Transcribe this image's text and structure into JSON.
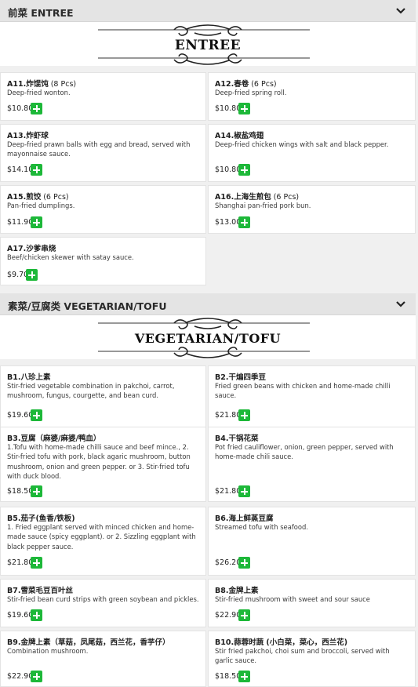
{
  "sections": [
    {
      "title": "前菜 ENTREE",
      "banner": "ENTREE",
      "items": [
        {
          "code": "A11.",
          "name": "炸馄饨",
          "suffix": " (8 Pcs)",
          "desc": "Deep-fried wonton.",
          "price": "$10.80"
        },
        {
          "code": "A12.",
          "name": "春卷",
          "suffix": " (6 Pcs)",
          "desc": "Deep-fried spring roll.",
          "price": "$10.80"
        },
        {
          "code": "A13.",
          "name": "炸虾球",
          "suffix": "",
          "desc": "Deep-fried prawn balls with egg and bread, served with mayonnaise sauce.",
          "price": "$14.10"
        },
        {
          "code": "A14.",
          "name": "椒盐鸡翅",
          "suffix": "",
          "desc": "Deep-fried chicken wings with salt and black pepper.",
          "price": "$10.80"
        },
        {
          "code": "A15.",
          "name": "煎饺",
          "suffix": " (6 Pcs)",
          "desc": "Pan-fried dumplings.",
          "price": "$11.90"
        },
        {
          "code": "A16.",
          "name": "上海生煎包",
          "suffix": " (6 Pcs)",
          "desc": "Shanghai pan-fried pork bun.",
          "price": "$13.00"
        },
        {
          "code": "A17.",
          "name": "沙爹串烧",
          "suffix": "",
          "desc": "Beef/chicken skewer with satay sauce.",
          "price": "$9.70"
        }
      ]
    },
    {
      "title": "素菜/豆腐类 VEGETARIAN/TOFU",
      "banner": "VEGETARIAN/TOFU",
      "items": [
        {
          "code": "B1.",
          "name": "八珍上素",
          "suffix": "",
          "desc": "Stir-fried vegetable combination in pakchoi, carrot, mushroom, fungus, courgette, and bean curd.",
          "price": "$19.60"
        },
        {
          "code": "B2.",
          "name": "干煸四季豆",
          "suffix": "",
          "desc": "Fried green beans with chicken and home-made chilli sauce.",
          "price": "$21.80"
        },
        {
          "code": "B3.",
          "name": "豆腐（麻婆/麻婆/鸭血）",
          "suffix": "",
          "desc": "1.Tofu with home-made chilli sauce and beef mince., 2. Stir-fried tofu with pork, black agaric mushroom, button mushroom, onion and green pepper. or 3. Stir-fried tofu with duck blood.",
          "price": "$18.50"
        },
        {
          "code": "B4.",
          "name": "干锅花菜",
          "suffix": "",
          "desc": "Pot fried cauliflower, onion, green pepper, served with home-made chili sauce.",
          "price": "$21.80"
        },
        {
          "code": "B5.",
          "name": "茄子(鱼香/铁板)",
          "suffix": "",
          "desc": "1. Fried eggplant served with minced chicken and home-made sauce (spicy eggplant). or 2. Sizzling eggplant with black pepper sauce.",
          "price": "$21.80"
        },
        {
          "code": "B6.",
          "name": "海上鲜蒸豆腐",
          "suffix": "",
          "desc": "Streamed tofu with seafood.",
          "price": "$26.20"
        },
        {
          "code": "B7.",
          "name": "雪菜毛豆百叶丝",
          "suffix": "",
          "desc": "Stir-fried bean curd strips with green soybean and pickles.",
          "price": "$19.60"
        },
        {
          "code": "B8.",
          "name": "金牌上素",
          "suffix": "",
          "desc": "Stir-fried mushroom with sweet and sour sauce",
          "price": "$22.90"
        },
        {
          "code": "B9.",
          "name": "金牌上素（草菇，凤尾菇，西兰花，香芋仔）",
          "suffix": "",
          "desc": "Combination mushroom.",
          "price": "$22.90"
        },
        {
          "code": "B10.",
          "name": "蒜蓉时蔬 (小白菜，菜心，西兰花)",
          "suffix": "",
          "desc": "Stir fried pakchoi, choi sum and broccoli, served with garlic sauce.",
          "price": "$18.50"
        }
      ]
    }
  ],
  "colors": {
    "add_button": "#1db839",
    "header_bg": "#e4e4e4",
    "page_bg": "#f0f0f0"
  },
  "icons": {
    "collapse": "chevron-down-icon",
    "add": "plus-icon",
    "banner_ornament": "scroll-ornament-icon"
  }
}
